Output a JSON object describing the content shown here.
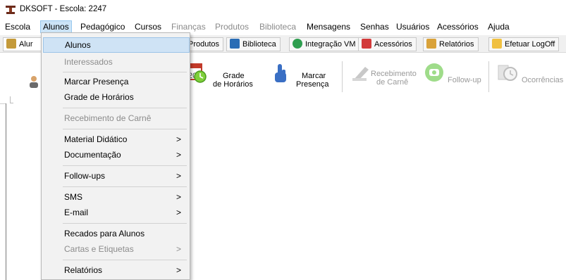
{
  "window": {
    "title": "DKSOFT - Escola: 2247"
  },
  "menubar": [
    {
      "label": "Escola",
      "disabled": false
    },
    {
      "label": "Alunos",
      "disabled": false,
      "active": true
    },
    {
      "label": "Pedagógico",
      "disabled": false
    },
    {
      "label": "Cursos",
      "disabled": false
    },
    {
      "label": "Finanças",
      "disabled": true
    },
    {
      "label": "Produtos",
      "disabled": true
    },
    {
      "label": "Biblioteca",
      "disabled": true
    },
    {
      "label": "Mensagens",
      "disabled": false
    },
    {
      "label": "Senhas",
      "disabled": false
    },
    {
      "label": "Usuários",
      "disabled": false
    },
    {
      "label": "Acessórios",
      "disabled": false
    },
    {
      "label": "Ajuda",
      "disabled": false
    }
  ],
  "tabs": [
    {
      "label": "Alur",
      "icon": "students-icon",
      "color": "#c49a3a"
    },
    {
      "label": "Produtos",
      "icon": "box-icon",
      "color": "#b0b0b0"
    },
    {
      "label": "Biblioteca",
      "icon": "book-icon",
      "color": "#2a6db5"
    },
    {
      "label": "Integração VM",
      "icon": "globe-icon",
      "color": "#2e9e4f"
    },
    {
      "label": "Acessórios",
      "icon": "tools-icon",
      "color": "#d23a3a"
    },
    {
      "label": "Relatórios",
      "icon": "report-icon",
      "color": "#d9a23a"
    },
    {
      "label": "Efetuar LogOff",
      "icon": "key-icon",
      "color": "#f0c040"
    }
  ],
  "toolbar": [
    {
      "label1": "Grade",
      "label2": "de Horários",
      "icon": "calendar-clock-icon",
      "disabled": false
    },
    {
      "label1": "Marcar",
      "label2": "Presença",
      "icon": "raised-hand-icon",
      "disabled": false
    },
    {
      "label1": "Recebimento",
      "label2": "de Carnê",
      "icon": "stamp-icon",
      "disabled": true
    },
    {
      "label1": "Follow-up",
      "label2": "",
      "icon": "phone-icon",
      "disabled": true
    },
    {
      "label1": "Ocorrências",
      "label2": "",
      "icon": "alarm-clock-icon",
      "disabled": true
    }
  ],
  "dropdown": [
    {
      "label": "Alunos",
      "disabled": false,
      "submenu": false,
      "highlight": true
    },
    {
      "label": "Interessados",
      "disabled": true,
      "submenu": false
    },
    {
      "label": "Marcar Presença",
      "disabled": false,
      "submenu": false
    },
    {
      "label": "Grade de Horários",
      "disabled": false,
      "submenu": false
    },
    {
      "label": "Recebimento de Carnê",
      "disabled": true,
      "submenu": false
    },
    {
      "label": "Material Didático",
      "disabled": false,
      "submenu": true
    },
    {
      "label": "Documentação",
      "disabled": false,
      "submenu": true
    },
    {
      "label": "Follow-ups",
      "disabled": false,
      "submenu": true
    },
    {
      "label": "SMS",
      "disabled": false,
      "submenu": true
    },
    {
      "label": "E-mail",
      "disabled": false,
      "submenu": true
    },
    {
      "label": "Recados para Alunos",
      "disabled": false,
      "submenu": false
    },
    {
      "label": "Cartas e Etiquetas",
      "disabled": true,
      "submenu": true
    },
    {
      "label": "Relatórios",
      "disabled": false,
      "submenu": true
    }
  ],
  "submenu_arrow": ">"
}
